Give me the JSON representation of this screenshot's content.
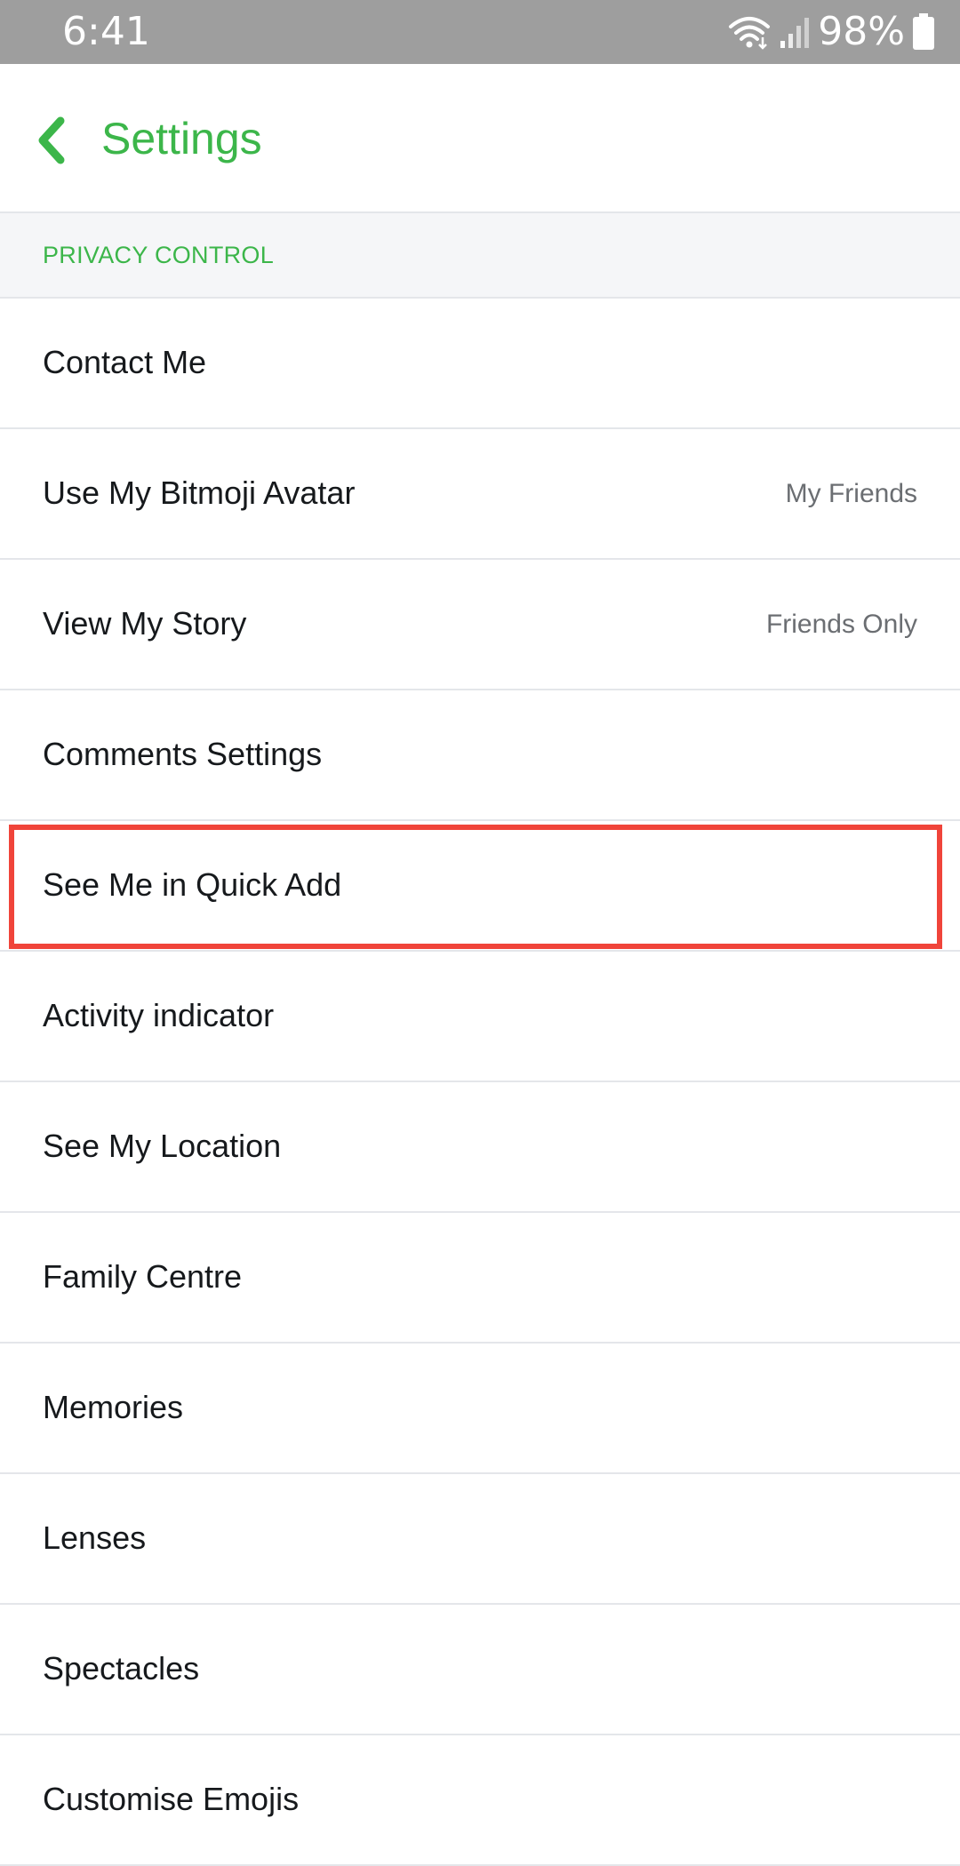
{
  "status_bar": {
    "time": "6:41",
    "battery": "98%",
    "icons": [
      "wifi-icon",
      "signal-icon",
      "battery-icon"
    ]
  },
  "header": {
    "title": "Settings",
    "back_icon": "chevron-left-icon"
  },
  "section": {
    "title": "PRIVACY CONTROL"
  },
  "items": [
    {
      "label": "Contact Me",
      "value": ""
    },
    {
      "label": "Use My Bitmoji Avatar",
      "value": "My Friends"
    },
    {
      "label": "View My Story",
      "value": "Friends Only"
    },
    {
      "label": "Comments Settings",
      "value": ""
    },
    {
      "label": "See Me in Quick Add",
      "value": "",
      "highlighted": true
    },
    {
      "label": "Activity indicator",
      "value": ""
    },
    {
      "label": "See My Location",
      "value": ""
    },
    {
      "label": "Family Centre",
      "value": ""
    },
    {
      "label": "Memories",
      "value": ""
    },
    {
      "label": "Lenses",
      "value": ""
    },
    {
      "label": "Spectacles",
      "value": ""
    },
    {
      "label": "Customise Emojis",
      "value": ""
    }
  ],
  "colors": {
    "accent": "#3cb64a",
    "highlight": "#f0443a",
    "status_bar": "#9e9e9e",
    "section_bg": "#f5f6f8",
    "divider": "#e4e6ea"
  }
}
